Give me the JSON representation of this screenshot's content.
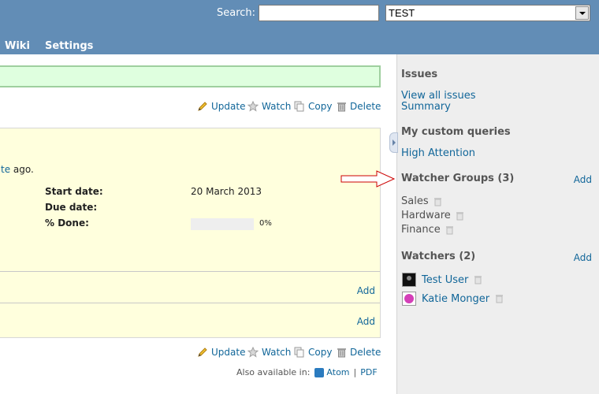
{
  "header": {
    "search_label": "Search:",
    "search_value": "",
    "project_select_value": "TEST",
    "menu": [
      "Wiki",
      "Settings"
    ]
  },
  "actions": {
    "update": "Update",
    "watch": "Watch",
    "copy": "Copy",
    "delete": "Delete"
  },
  "issue": {
    "ago_link": "te",
    "ago_text": " ago.",
    "attributes": [
      {
        "label": "Start date:",
        "value": "20 March 2013"
      },
      {
        "label": "Due date:",
        "value": ""
      },
      {
        "label": "% Done:",
        "value": ""
      }
    ],
    "done_percent": 0,
    "done_text": "0%",
    "add_label_1": "Add",
    "add_label_2": "Add"
  },
  "footer": {
    "also_available": "Also available in:",
    "atom": "Atom",
    "separator": "|",
    "pdf": "PDF"
  },
  "sidebar": {
    "issues_heading": "Issues",
    "view_all": "View all issues",
    "summary": "Summary",
    "custom_queries_heading": "My custom queries",
    "high_attention": "High Attention",
    "watcher_groups_heading": "Watcher Groups (3)",
    "watcher_groups_add": "Add",
    "groups": [
      "Sales",
      "Hardware",
      "Finance"
    ],
    "watchers_heading": "Watchers (2)",
    "watchers_add": "Add",
    "watchers": [
      "Test User",
      "Katie Monger"
    ]
  },
  "colors": {
    "header_bg": "#628db6",
    "link": "#169",
    "issue_bg": "#ffffdd",
    "flash_bg": "#dfffdf",
    "sidebar_bg": "#eeeeee",
    "annotation_arrow": "#cc0000"
  },
  "icons": [
    "pencil-icon",
    "star-icon",
    "copy-icon",
    "trash-icon",
    "feed-icon",
    "arrow-annotation-icon"
  ]
}
